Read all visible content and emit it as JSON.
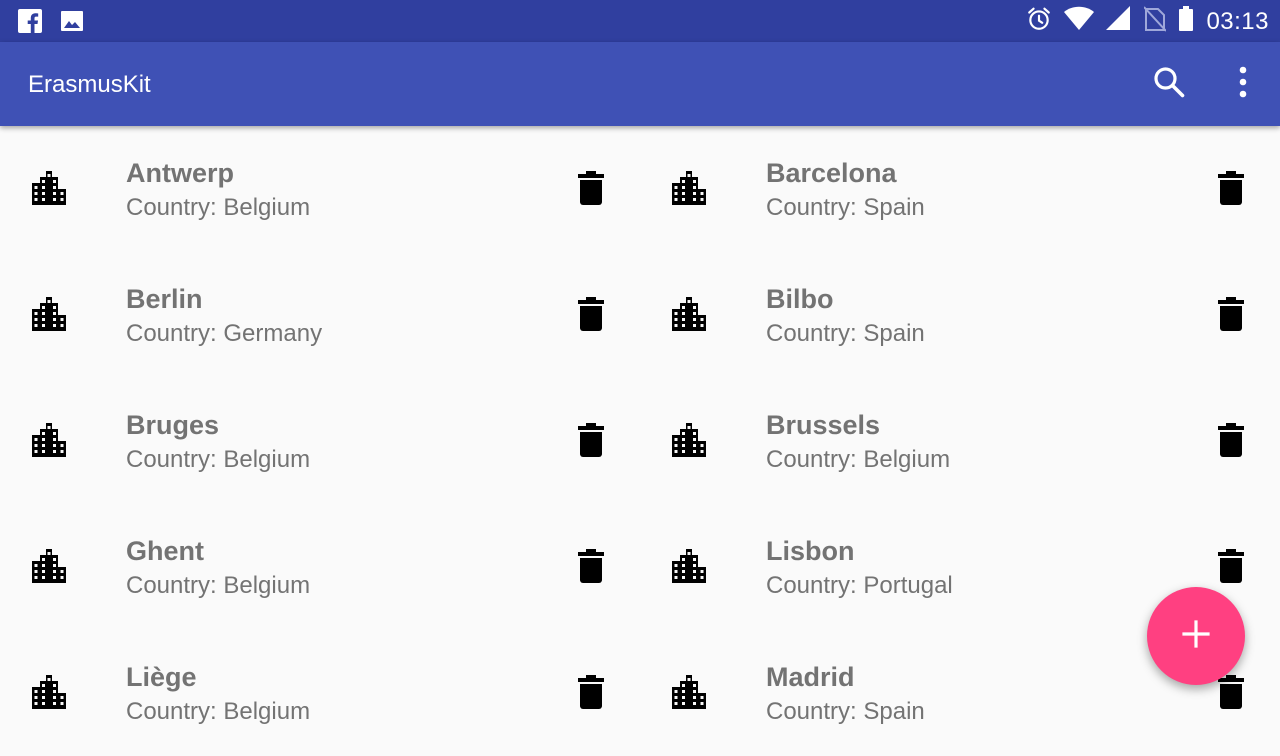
{
  "status_bar": {
    "time": "03:13",
    "left_icons": [
      "facebook-icon",
      "image-icon"
    ],
    "right_icons": [
      "alarm-icon",
      "wifi-icon",
      "signal-icon",
      "no-sim-icon",
      "battery-icon"
    ]
  },
  "app_bar": {
    "title": "ErasmusKit",
    "actions": [
      "search-icon",
      "more-vert-icon"
    ]
  },
  "cities": [
    {
      "name": "Antwerp",
      "country": "Country: Belgium"
    },
    {
      "name": "Barcelona",
      "country": "Country: Spain"
    },
    {
      "name": "Berlin",
      "country": "Country: Germany"
    },
    {
      "name": "Bilbo",
      "country": "Country: Spain"
    },
    {
      "name": "Bruges",
      "country": "Country: Belgium"
    },
    {
      "name": "Brussels",
      "country": "Country: Belgium"
    },
    {
      "name": "Ghent",
      "country": "Country: Belgium"
    },
    {
      "name": "Lisbon",
      "country": "Country: Portugal"
    },
    {
      "name": "Liège",
      "country": "Country: Belgium"
    },
    {
      "name": "Madrid",
      "country": "Country: Spain"
    }
  ],
  "fab": {
    "icon": "add-icon"
  },
  "colors": {
    "status_bar": "#303f9f",
    "app_bar": "#3f51b5",
    "fab": "#ff4081",
    "background": "#fafafa",
    "text_secondary": "#737373"
  }
}
